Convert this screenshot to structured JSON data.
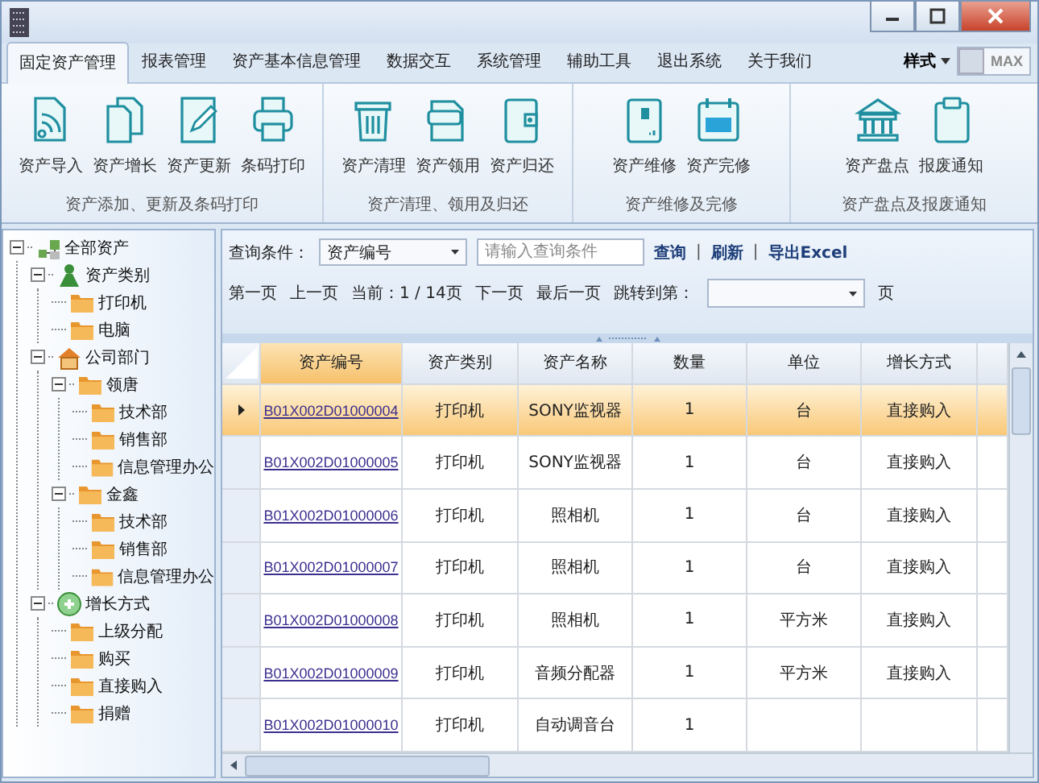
{
  "menu_tabs": [
    {
      "label": "固定资产管理",
      "selected": true
    },
    {
      "label": "报表管理",
      "selected": false
    },
    {
      "label": "资产基本信息管理",
      "selected": false
    },
    {
      "label": "数据交互",
      "selected": false
    },
    {
      "label": "系统管理",
      "selected": false
    },
    {
      "label": "辅助工具",
      "selected": false
    },
    {
      "label": "退出系统",
      "selected": false
    },
    {
      "label": "关于我们",
      "selected": false
    }
  ],
  "style_menu": {
    "label": "样式"
  },
  "max_toggle": {
    "label": "MAX",
    "on": false
  },
  "ribbon": {
    "groups": [
      {
        "label": "资产添加、更新及条码打印",
        "buttons": [
          {
            "label": "资产导入",
            "kind": "feed"
          },
          {
            "label": "资产增长",
            "kind": "copy"
          },
          {
            "label": "资产更新",
            "kind": "edit"
          },
          {
            "label": "条码打印",
            "kind": "printer"
          }
        ]
      },
      {
        "label": "资产清理、领用及归还",
        "buttons": [
          {
            "label": "资产清理",
            "kind": "trash"
          },
          {
            "label": "资产领用",
            "kind": "folder"
          },
          {
            "label": "资产归还",
            "kind": "wallet"
          }
        ]
      },
      {
        "label": "资产维修及完修",
        "buttons": [
          {
            "label": "资产维修",
            "kind": "box"
          },
          {
            "label": "资产完修",
            "kind": "calendar"
          }
        ]
      },
      {
        "label": "资产盘点及报废通知",
        "buttons": [
          {
            "label": "资产盘点",
            "kind": "bank"
          },
          {
            "label": "报废通知",
            "kind": "clipboard"
          }
        ]
      }
    ]
  },
  "tree": [
    {
      "label": "全部资产",
      "kind": "root",
      "expanded": true,
      "children": [
        {
          "label": "资产类别",
          "kind": "people",
          "expanded": true,
          "children": [
            {
              "label": "打印机",
              "kind": "folder"
            },
            {
              "label": "电脑",
              "kind": "folder"
            }
          ]
        },
        {
          "label": "公司部门",
          "kind": "house",
          "expanded": true,
          "children": [
            {
              "label": "领唐",
              "kind": "folder",
              "expanded": true,
              "children": [
                {
                  "label": "技术部",
                  "kind": "folder"
                },
                {
                  "label": "销售部",
                  "kind": "folder"
                },
                {
                  "label": "信息管理办公",
                  "kind": "folder"
                }
              ]
            },
            {
              "label": "金鑫",
              "kind": "folder",
              "expanded": true,
              "children": [
                {
                  "label": "技术部",
                  "kind": "folder"
                },
                {
                  "label": "销售部",
                  "kind": "folder"
                },
                {
                  "label": "信息管理办公",
                  "kind": "folder"
                }
              ]
            }
          ]
        },
        {
          "label": "增长方式",
          "kind": "circle",
          "expanded": true,
          "children": [
            {
              "label": "上级分配",
              "kind": "folder"
            },
            {
              "label": "购买",
              "kind": "folder"
            },
            {
              "label": "直接购入",
              "kind": "folder"
            },
            {
              "label": "捐赠",
              "kind": "folder"
            }
          ]
        }
      ]
    }
  ],
  "query": {
    "label": "查询条件：",
    "field_select": {
      "value": "资产编号"
    },
    "search_field": {
      "placeholder": "请输入查询条件"
    },
    "links": [
      "查询",
      "刷新",
      "导出Excel"
    ],
    "separator": "|"
  },
  "pager": {
    "first": "第一页",
    "prev": "上一页",
    "current": "当前：1 / 14页",
    "next": "下一页",
    "last": "最后一页",
    "jump_label": "跳转到第：",
    "page_suffix": "页"
  },
  "table": {
    "columns": [
      "资产编号",
      "资产类别",
      "资产名称",
      "数量",
      "单位",
      "增长方式"
    ],
    "rows": [
      {
        "selected": true,
        "cells": [
          "B01X002D01000004",
          "打印机",
          "SONY监视器",
          "1",
          "台",
          "直接购入"
        ]
      },
      {
        "selected": false,
        "cells": [
          "B01X002D01000005",
          "打印机",
          "SONY监视器",
          "1",
          "台",
          "直接购入"
        ]
      },
      {
        "selected": false,
        "cells": [
          "B01X002D01000006",
          "打印机",
          "照相机",
          "1",
          "台",
          "直接购入"
        ]
      },
      {
        "selected": false,
        "cells": [
          "B01X002D01000007",
          "打印机",
          "照相机",
          "1",
          "台",
          "直接购入"
        ]
      },
      {
        "selected": false,
        "cells": [
          "B01X002D01000008",
          "打印机",
          "照相机",
          "1",
          "平方米",
          "直接购入"
        ]
      },
      {
        "selected": false,
        "cells": [
          "B01X002D01000009",
          "打印机",
          "音频分配器",
          "1",
          "平方米",
          "直接购入"
        ]
      },
      {
        "selected": false,
        "cells": [
          "B01X002D01000010",
          "打印机",
          "自动调音台",
          "1"
        ]
      }
    ]
  }
}
